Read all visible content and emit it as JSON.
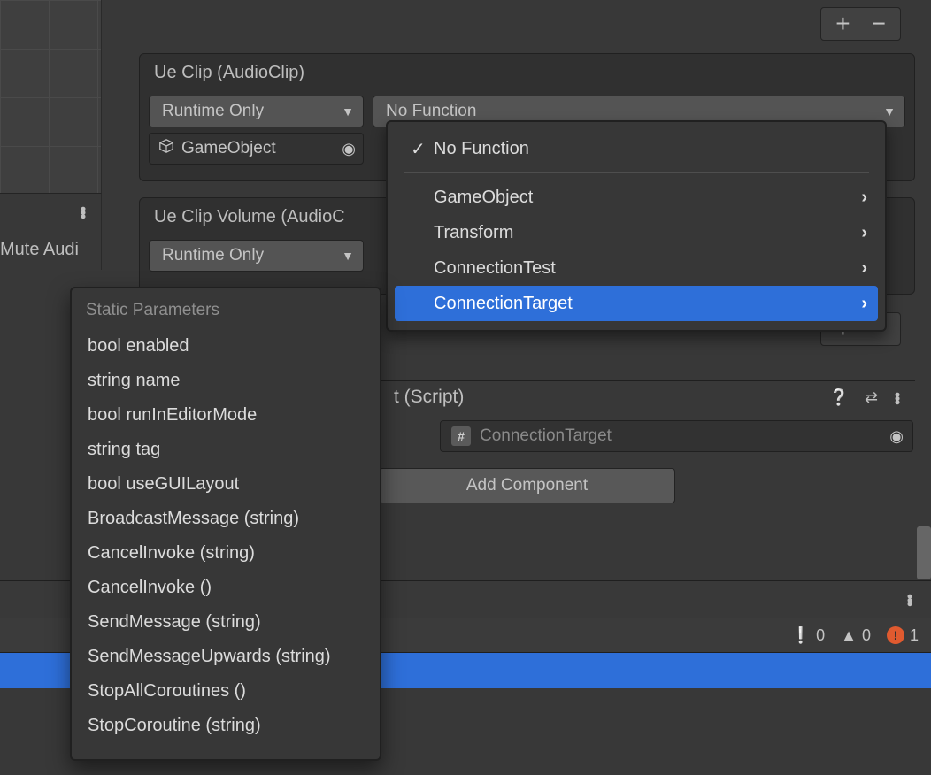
{
  "left": {
    "truncated_label": "Mute Audi"
  },
  "toolbar": {
    "plus": "+",
    "minus": "−"
  },
  "section1": {
    "title": "Ue Clip (AudioClip)",
    "runtime_label": "Runtime Only",
    "function_label": "No Function",
    "object_label": "GameObject"
  },
  "section2": {
    "title": "Ue Clip Volume (AudioC",
    "runtime_label": "Runtime Only"
  },
  "component": {
    "title_suffix": "t (Script)",
    "script_name": "ConnectionTarget",
    "add_label": "Add Component"
  },
  "func_popup": {
    "no_function": "No Function",
    "items": [
      {
        "label": "GameObject"
      },
      {
        "label": "Transform"
      },
      {
        "label": "ConnectionTest"
      },
      {
        "label": "ConnectionTarget"
      }
    ],
    "selected_index": 3
  },
  "param_popup": {
    "header": "Static Parameters",
    "items": [
      "bool enabled",
      "string name",
      "bool runInEditorMode",
      "string tag",
      "bool useGUILayout",
      "BroadcastMessage (string)",
      "CancelInvoke (string)",
      "CancelInvoke ()",
      "SendMessage (string)",
      "SendMessageUpwards (string)",
      "StopAllCoroutines ()",
      "StopCoroutine (string)"
    ]
  },
  "status": {
    "info_count": "0",
    "warn_count": "0",
    "err_count": "1"
  }
}
